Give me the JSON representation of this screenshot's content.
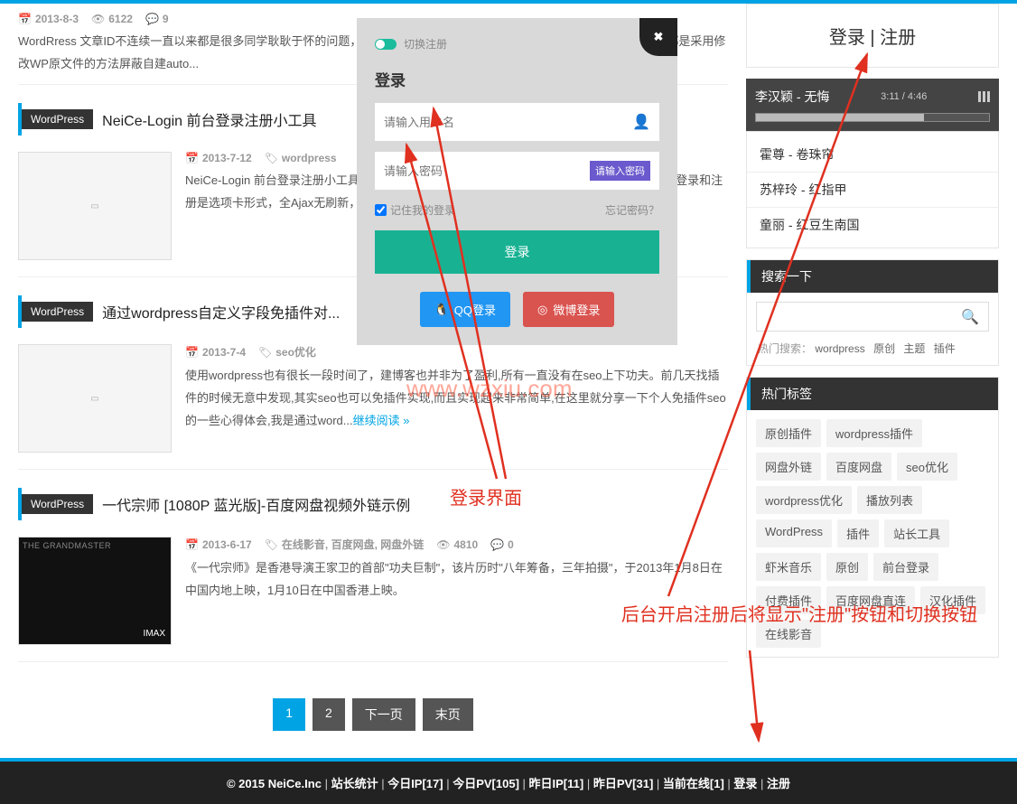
{
  "posts": [
    {
      "date": "2013-8-3",
      "views": "6122",
      "comments": "9",
      "excerpt": "WordRress 文章ID不连续一直以来都是很多同学耿耿于怀的问题，尤其是对于强迫症患者，真是一大致命伤。其实，90%以上都是采用修改WP原文件的方法屏蔽自建auto..."
    },
    {
      "cat": "WordPress",
      "title": "NeiCe-Login 前台登录注册小工具",
      "date": "2013-7-12",
      "tags": "wordpress",
      "excerpt": "NeiCe-Login 前台登录注册小工具，支持前台Ajax登录注册，使用很简单，安装激活插件即可。登录和注册是选项卡形式，全Ajax无刷新，带前台切换功能 丢失密码找回功能..."
    },
    {
      "cat": "WordPress",
      "title": "通过wordpress自定义字段免插件对...",
      "date": "2013-7-4",
      "tags": "seo优化",
      "excerpt": "使用wordpress也有很长一段时间了，建博客也并非为了盈利,所有一直没有在seo上下功夫。前几天找插件的时候无意中发现,其实seo也可以免插件实现,而且实现起来非常简单,在这里就分享一下个人免插件seo的一些心得体会,我是通过word...",
      "readmore": "继续阅读 »"
    },
    {
      "cat": "WordPress",
      "title": "一代宗师 [1080P 蓝光版]-百度网盘视频外链示例",
      "date": "2013-6-17",
      "tags": "在线影音, 百度网盘, 网盘外链",
      "views": "4810",
      "comments": "0",
      "excerpt": "《一代宗师》是香港导演王家卫的首部\"功夫巨制\"，该片历时\"八年筹备，三年拍摄\"，于2013年1月8日在中国内地上映，1月10日在中国香港上映。"
    }
  ],
  "modal": {
    "toggle_label": "切换注册",
    "title": "登录",
    "username_ph": "请输入用户名",
    "password_ph": "请输入密码",
    "pwd_btn": "请输入密码",
    "remember": "记住我的登录",
    "forgot": "忘记密码？",
    "login_btn": "登录",
    "qq": "QQ登录",
    "weibo": "微博登录"
  },
  "sidebar": {
    "login": "登录",
    "register": "注册",
    "player": {
      "track": "李汉颖 - 无悔",
      "time": "3:11 / 4:46"
    },
    "playlist": [
      "霍尊 - 卷珠帘",
      "苏梓玲 - 红指甲",
      "童丽 - 红豆生南国"
    ],
    "search_head": "搜索一下",
    "hot_label": "热门搜索：",
    "hot": [
      "wordpress",
      "原创",
      "主题",
      "插件"
    ],
    "tags_head": "热门标签",
    "tags": [
      "原创插件",
      "wordpress插件",
      "网盘外链",
      "百度网盘",
      "seo优化",
      "wordpress优化",
      "播放列表",
      "WordPress",
      "插件",
      "站长工具",
      "虾米音乐",
      "原创",
      "前台登录",
      "付费插件",
      "百度网盘直连",
      "汉化插件",
      "在线影音"
    ]
  },
  "pagination": {
    "p1": "1",
    "p2": "2",
    "next": "下一页",
    "last": "末页"
  },
  "footer": {
    "copyright": "© 2015 NeiCe.Inc",
    "items": [
      "站长统计",
      "今日IP[17]",
      "今日PV[105]",
      "昨日IP[11]",
      "昨日PV[31]",
      "当前在线[1]",
      "登录",
      "注册"
    ]
  },
  "annotation": {
    "login_ui": "登录界面",
    "reg_note": "后台开启注册后将显示\"注册\"按钮和切换按钮"
  },
  "watermark": "www.wzxiu.com"
}
